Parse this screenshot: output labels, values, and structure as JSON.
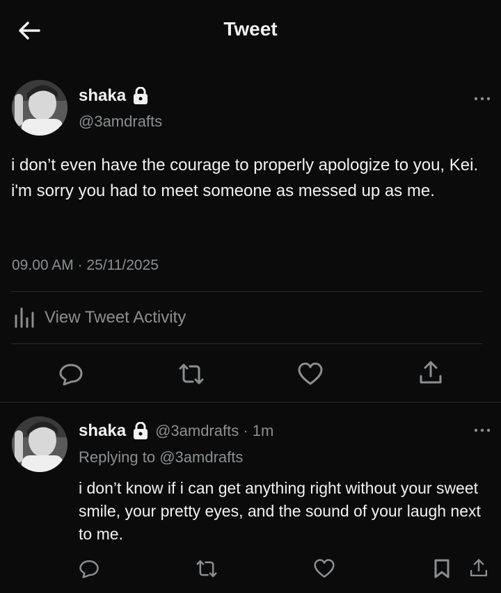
{
  "header": {
    "title": "Tweet"
  },
  "main_tweet": {
    "name": "shaka",
    "handle": "@3amdrafts",
    "text": "i don’t even have the courage to properly apologize to you, Kei. i'm sorry you had to meet someone as messed up as me.",
    "timestamp": "09.00 AM · 25/11/2025",
    "activity_label": "View Tweet Activity"
  },
  "reply": {
    "name": "shaka",
    "handle_time": "@3amdrafts · 1m",
    "replying_prefix": "Replying to",
    "replying_handle": "@3amdrafts",
    "text": "i don’t know if i can get anything right without your sweet smile, your pretty eyes, and the sound of your laugh next to me."
  },
  "colors": {
    "background": "#0b0b0b",
    "text": "#f2f2f2",
    "muted": "#8b8f93",
    "divider": "#2b2b2b"
  },
  "icons": [
    "back-arrow-icon",
    "lock-icon",
    "more-icon",
    "activity-bars-icon",
    "reply-icon",
    "retweet-icon",
    "like-icon",
    "share-icon",
    "bookmark-icon"
  ]
}
